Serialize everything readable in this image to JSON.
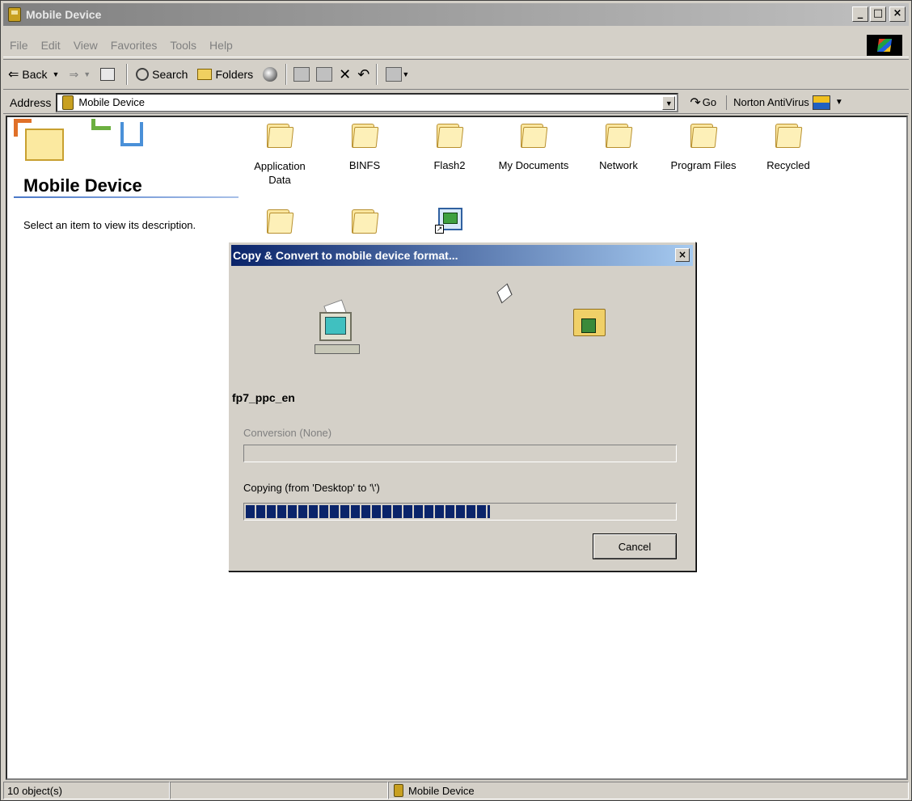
{
  "window": {
    "title": "Mobile Device"
  },
  "menu": [
    "File",
    "Edit",
    "View",
    "Favorites",
    "Tools",
    "Help"
  ],
  "toolbar": {
    "back": "Back",
    "search": "Search",
    "folders": "Folders"
  },
  "address": {
    "label": "Address",
    "value": "Mobile Device",
    "go": "Go",
    "norton": "Norton AntiVirus"
  },
  "leftpanel": {
    "title": "Mobile Device",
    "description": "Select an item to view its description."
  },
  "items": [
    {
      "label": "Application Data",
      "icon": "folder-icon"
    },
    {
      "label": "BINFS",
      "icon": "folder-icon"
    },
    {
      "label": "Flash2",
      "icon": "folder-icon"
    },
    {
      "label": "My Documents",
      "icon": "folder-icon"
    },
    {
      "label": "Network",
      "icon": "folder-icon"
    },
    {
      "label": "Program Files",
      "icon": "folder-icon"
    },
    {
      "label": "Recycled",
      "icon": "folder-icon"
    },
    {
      "label": "",
      "icon": "folder-icon"
    },
    {
      "label": "",
      "icon": "folder-icon"
    },
    {
      "label": "",
      "icon": "shortcut-icon"
    }
  ],
  "dialog": {
    "title": "Copy & Convert to mobile device format...",
    "filename": "fp7_ppc_en",
    "conversion_label": "Conversion (None)",
    "copying_label": "Copying (from 'Desktop' to '\\')",
    "copy_progress": 0.57,
    "cancel": "Cancel"
  },
  "status": {
    "objects": "10 object(s)",
    "location": "Mobile Device"
  },
  "colors": {
    "dialog_title": "#0a246a",
    "progress": "#0a246a",
    "face": "#d4d0c8"
  }
}
